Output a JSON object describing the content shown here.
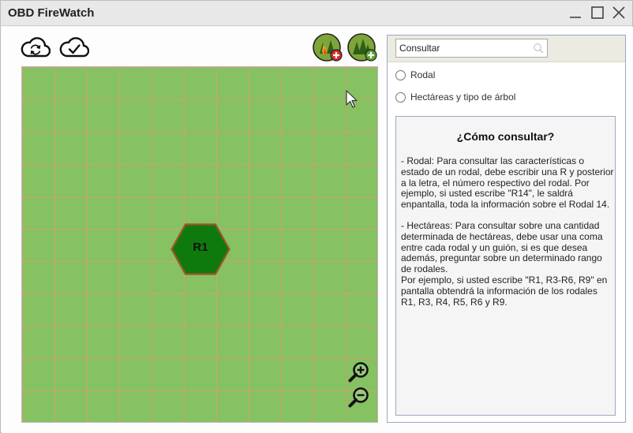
{
  "window": {
    "title": "OBD FireWatch",
    "controls": [
      "minimize-icon",
      "maximize-icon",
      "close-icon"
    ]
  },
  "toolbar": {
    "left_icons": [
      "cloud-sync-icon",
      "cloud-check-icon"
    ],
    "right_icons": [
      "add-fire-icon",
      "add-forest-icon"
    ]
  },
  "map": {
    "grid_color": "#d2a070",
    "background_color": "#86c162",
    "stand": {
      "label": "R1",
      "fill": "#0e7a0e",
      "stroke": "#a0522d"
    },
    "zoom_icons": [
      "zoom-in-icon",
      "zoom-out-icon"
    ]
  },
  "panel": {
    "search": {
      "value": "",
      "placeholder": "Consultar",
      "icon": "search-icon"
    },
    "options": [
      {
        "label": "Rodal",
        "selected": false
      },
      {
        "label": "Hectáreas y tipo de árbol",
        "selected": false
      }
    ],
    "help": {
      "title": "¿Cómo consultar?",
      "paragraphs": [
        "- Rodal: Para consultar las características o estado de un rodal, debe escribir una R y posterior a la letra, el número respectivo del rodal. Por ejemplo, si usted escribe \"R14\", le saldrá enpantalla, toda la información sobre el Rodal 14.",
        "- Hectáreas: Para consultar sobre una cantidad determinada de hectáreas, debe usar una coma entre cada rodal y un guión, si es que desea además, preguntar sobre un determinado rango de rodales.",
        "Por ejemplo, si usted escribe  \"R1, R3-R6, R9\" en pantalla obtendrá la información de los rodales R1, R3, R4, R5, R6 y R9."
      ]
    }
  }
}
